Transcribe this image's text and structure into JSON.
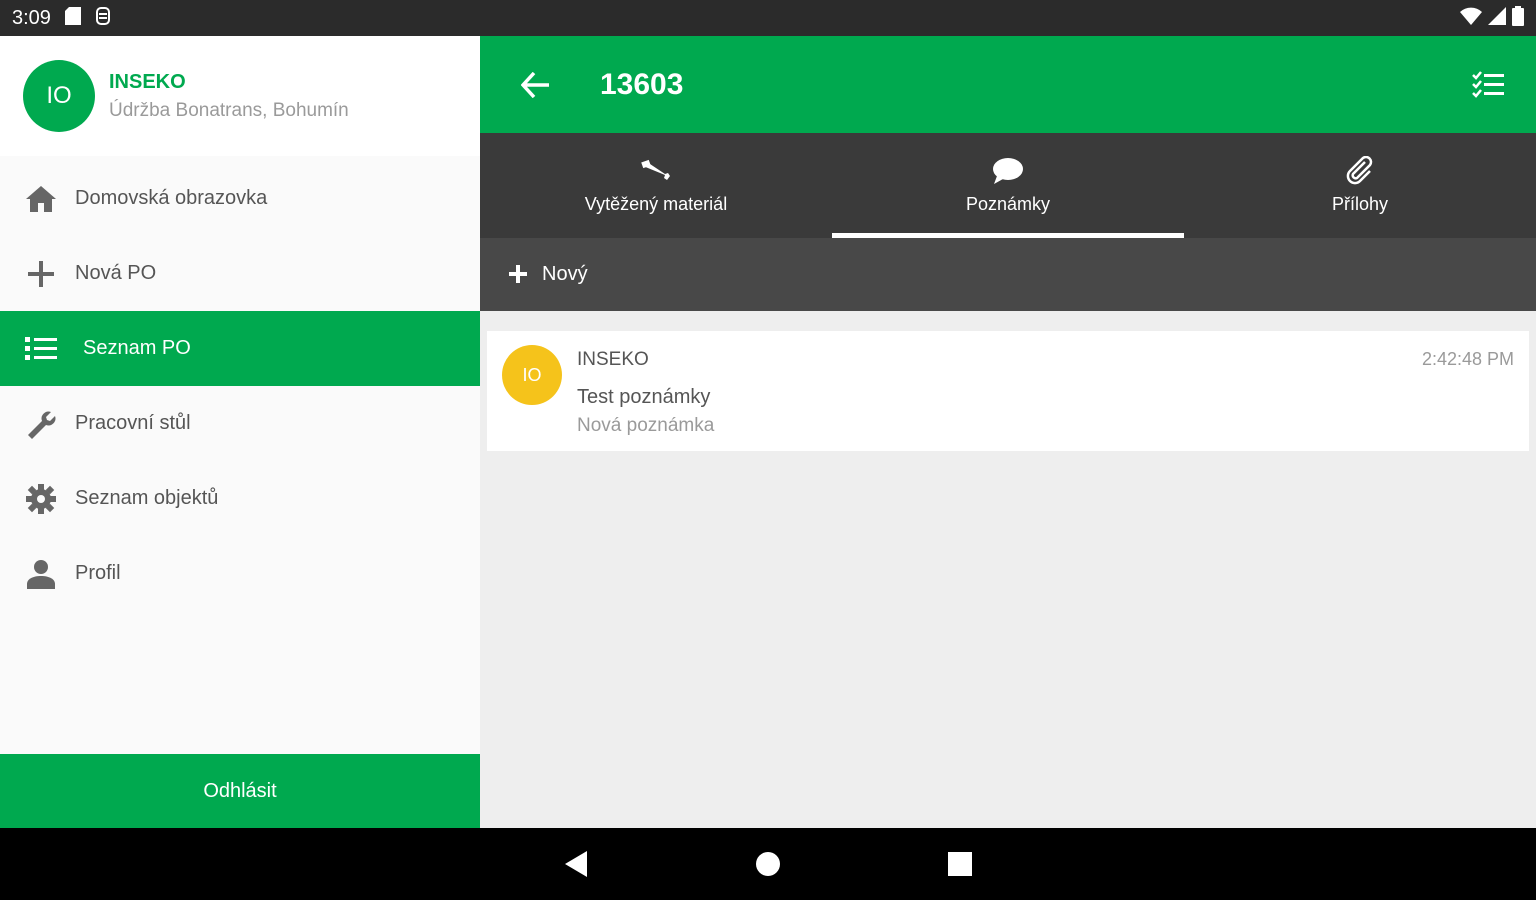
{
  "status_bar": {
    "time": "3:09"
  },
  "drawer": {
    "avatar_initials": "IO",
    "company": "INSEKO",
    "subtitle": "Údržba Bonatrans, Bohumín",
    "items": [
      {
        "label": "Domovská obrazovka",
        "icon": "home-icon"
      },
      {
        "label": "Nová PO",
        "icon": "plus-icon"
      },
      {
        "label": "Seznam PO",
        "icon": "list-icon",
        "active": true
      },
      {
        "label": "Pracovní stůl",
        "icon": "wrench-icon"
      },
      {
        "label": "Seznam objektů",
        "icon": "gear-icon"
      },
      {
        "label": "Profil",
        "icon": "person-icon"
      }
    ],
    "logout_label": "Odhlásit"
  },
  "appbar": {
    "title": "13603"
  },
  "tabs": [
    {
      "label": "Vytěžený materiál",
      "icon": "wrench-icon"
    },
    {
      "label": "Poznámky",
      "icon": "chat-icon",
      "selected": true
    },
    {
      "label": "Přílohy",
      "icon": "paperclip-icon"
    }
  ],
  "new_button_label": "Nový",
  "notes": [
    {
      "avatar_initials": "IO",
      "author": "INSEKO",
      "time": "2:42:48 PM",
      "title": "Test poznámky",
      "body": "Nová poznámka"
    }
  ],
  "colors": {
    "primary": "#00a94f",
    "dark": "#3a3a3a",
    "note_avatar": "#f5c31b"
  }
}
